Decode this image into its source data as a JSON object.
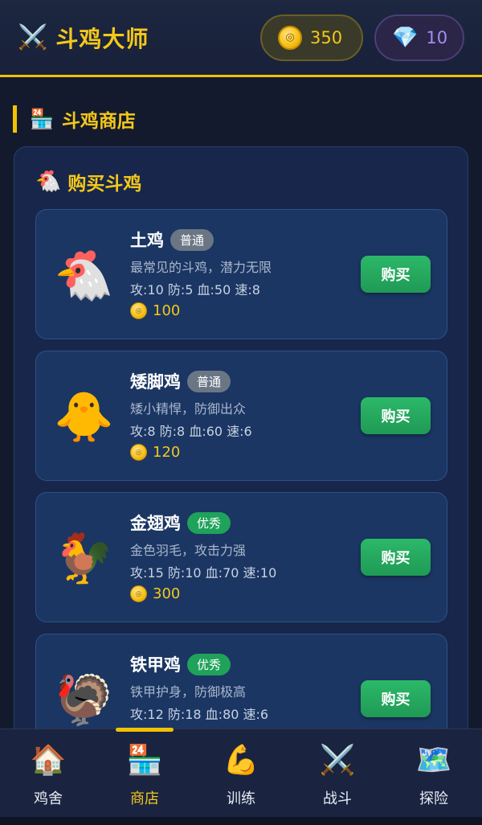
{
  "header": {
    "title": "斗鸡大师",
    "title_icon": "crossed-swords-icon",
    "gold": "350",
    "gems": "10"
  },
  "section": {
    "title": "斗鸡商店",
    "icon": "store-icon"
  },
  "shop": {
    "heading": "购买斗鸡",
    "heading_icon": "hen-icon",
    "items": [
      {
        "name": "土鸡",
        "rarity": "普通",
        "desc": "最常见的斗鸡，潜力无限",
        "stats": "攻:10 防:5 血:50 速:8",
        "price": "100",
        "buy_label": "购买",
        "icon": "chicken-icon"
      },
      {
        "name": "矮脚鸡",
        "rarity": "普通",
        "desc": "矮小精悍，防御出众",
        "stats": "攻:8 防:8 血:60 速:6",
        "price": "120",
        "buy_label": "购买",
        "icon": "chick-icon"
      },
      {
        "name": "金翅鸡",
        "rarity": "优秀",
        "desc": "金色羽毛，攻击力强",
        "stats": "攻:15 防:10 血:70 速:10",
        "price": "300",
        "buy_label": "购买",
        "icon": "rooster-icon"
      },
      {
        "name": "铁甲鸡",
        "rarity": "优秀",
        "desc": "铁甲护身，防御极高",
        "stats": "攻:12 防:18 血:80 速:6",
        "price": "",
        "buy_label": "购买",
        "icon": "turkey-icon"
      }
    ]
  },
  "nav": {
    "items": [
      {
        "label": "鸡舍",
        "icon": "house-icon"
      },
      {
        "label": "商店",
        "icon": "store-icon",
        "active": true
      },
      {
        "label": "训练",
        "icon": "flexed-bicep-icon"
      },
      {
        "label": "战斗",
        "icon": "crossed-swords-icon"
      },
      {
        "label": "探险",
        "icon": "world-map-icon"
      }
    ]
  },
  "colors": {
    "accent": "#f2c200",
    "buy_button": "#23a85e",
    "rarity_common": "#6b7685",
    "rarity_good": "#1fa25a"
  }
}
